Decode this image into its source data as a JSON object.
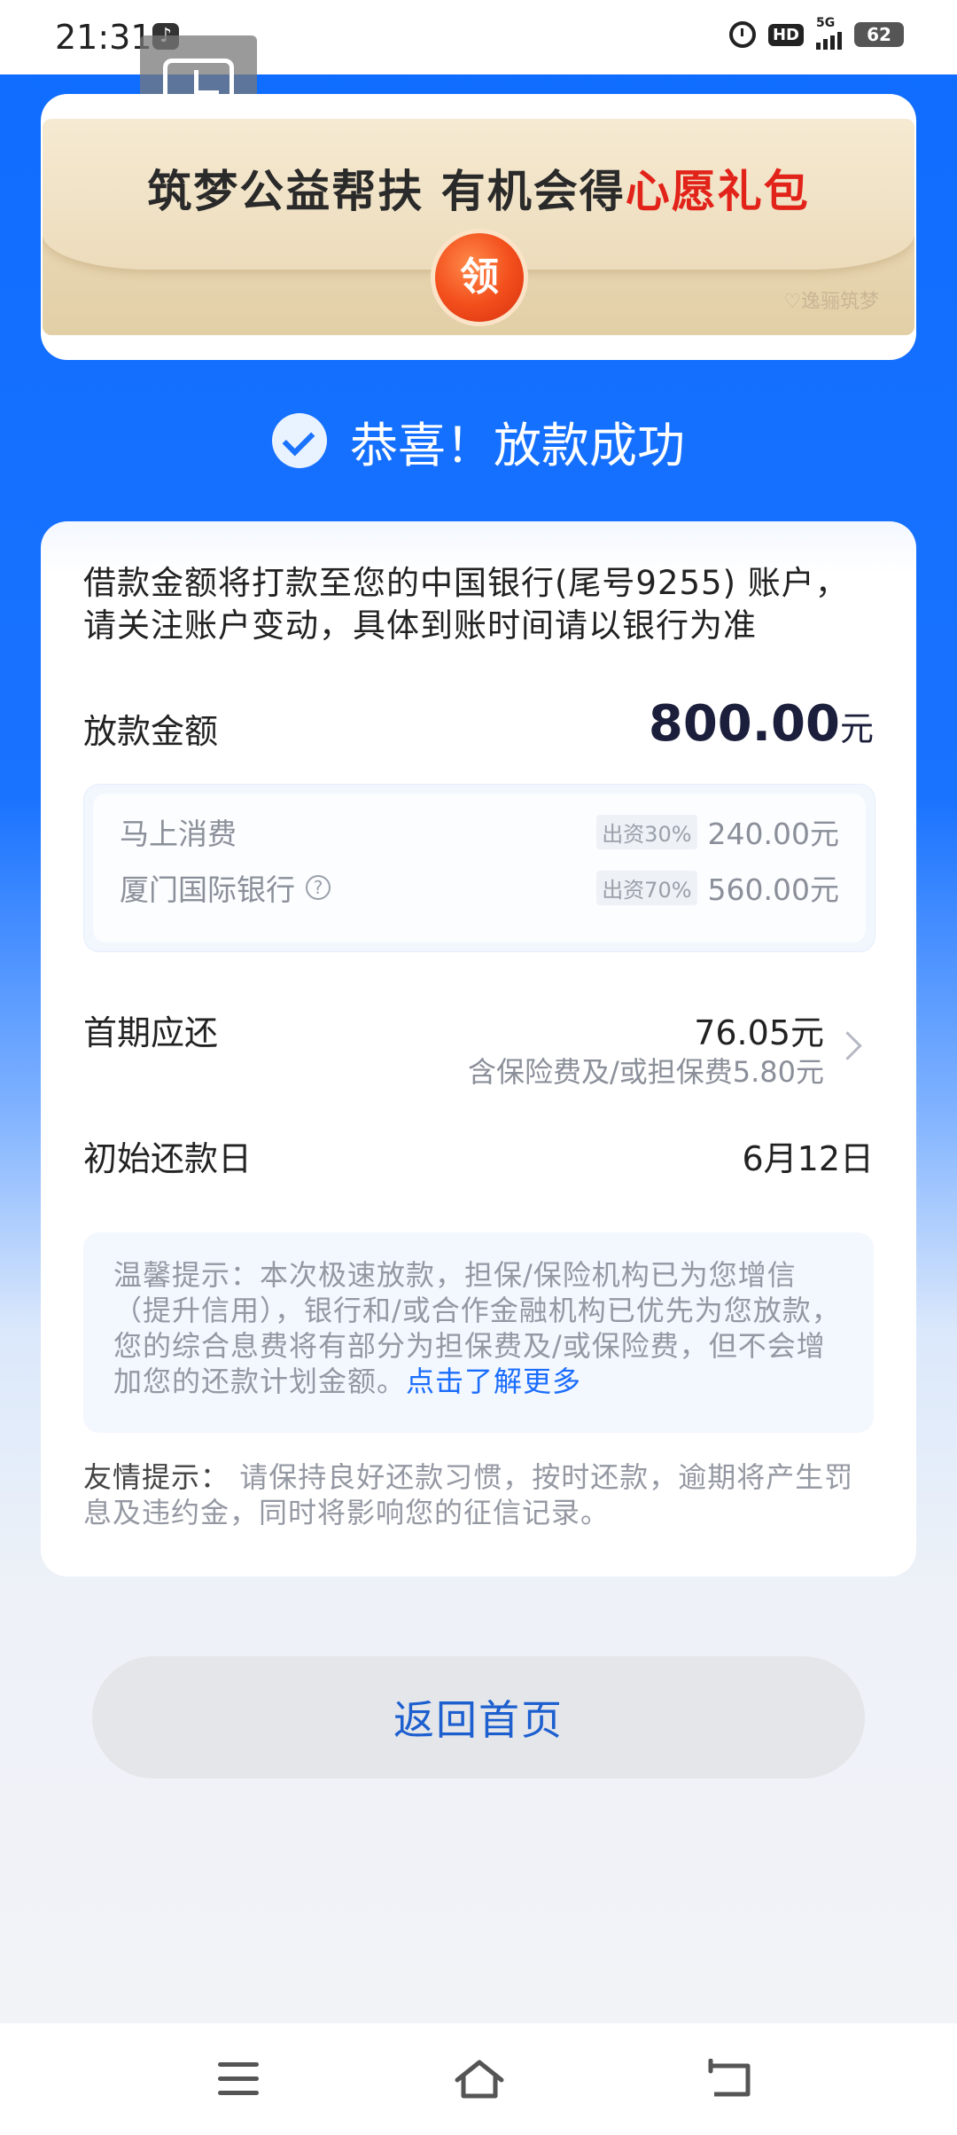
{
  "status_bar": {
    "time": "21:31",
    "hd": "HD",
    "network": "5G",
    "battery": "62"
  },
  "banner": {
    "text_main": "筑梦公益帮扶 有机会得",
    "text_highlight": "心愿礼包",
    "claim_label": "领",
    "brand": "♡逸骊筑梦"
  },
  "success": {
    "title": "恭喜！放款成功"
  },
  "card": {
    "notice": "借款金额将打款至您的中国银行(尾号9255) 账户，请关注账户变动，具体到账时间请以银行为准",
    "amount_label": "放款金额",
    "amount_value": "800.00",
    "amount_unit": "元",
    "funders": [
      {
        "name": "马上消费",
        "share": "出资30%",
        "amount": "240.00元"
      },
      {
        "name": "厦门国际银行",
        "share": "出资70%",
        "amount": "560.00元",
        "help": "?"
      }
    ],
    "first_label": "首期应还",
    "first_amount": "76.05元",
    "first_sub": "含保险费及/或担保费5.80元",
    "date_label": "初始还款日",
    "date_value": "6月12日",
    "tip_text": "温馨提示：本次极速放款，担保/保险机构已为您增信（提升信用），银行和/或合作金融机构已优先为您放款，您的综合息费将有部分为担保费及/或保险费，但不会增加您的还款计划金额。",
    "tip_link": "点击了解更多",
    "friendly_label": "友情提示：",
    "friendly_text": " 请保持良好还款习惯，按时还款，逾期将产生罚息及违约金，同时将影响您的征信记录。"
  },
  "actions": {
    "home_button": "返回首页"
  },
  "nav": {
    "icons": [
      "menu-icon",
      "home-icon",
      "back-icon"
    ]
  },
  "colors": {
    "brand_blue": "#1a73ff",
    "highlight_red": "#e2231a",
    "link_blue": "#1a6dff"
  }
}
